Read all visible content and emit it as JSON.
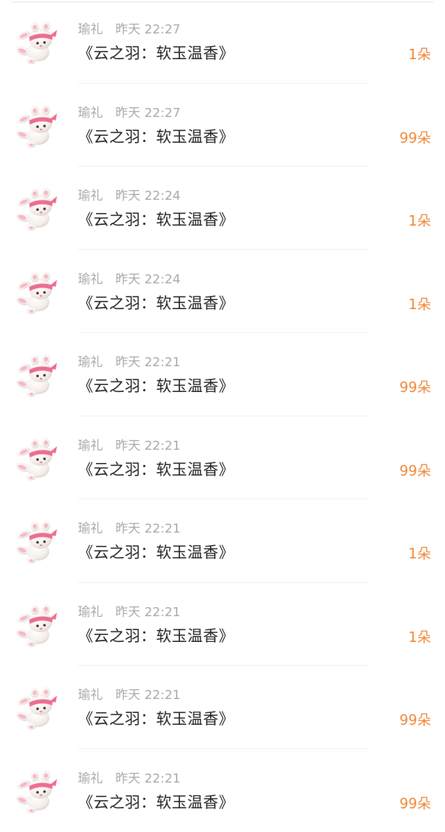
{
  "colors": {
    "name_time": "#a9a9a9",
    "title": "#222222",
    "count": "#f0883a",
    "divider": "#f0f0f0"
  },
  "avatar_icon": "pink-bunny-avatar-icon",
  "items": [
    {
      "name": "瑜礼",
      "time": "昨天 22:27",
      "title": "《云之羽：软玉温香》",
      "count": "1朵"
    },
    {
      "name": "瑜礼",
      "time": "昨天 22:27",
      "title": "《云之羽：软玉温香》",
      "count": "99朵"
    },
    {
      "name": "瑜礼",
      "time": "昨天 22:24",
      "title": "《云之羽：软玉温香》",
      "count": "1朵"
    },
    {
      "name": "瑜礼",
      "time": "昨天 22:24",
      "title": "《云之羽：软玉温香》",
      "count": "1朵"
    },
    {
      "name": "瑜礼",
      "time": "昨天 22:21",
      "title": "《云之羽：软玉温香》",
      "count": "99朵"
    },
    {
      "name": "瑜礼",
      "time": "昨天 22:21",
      "title": "《云之羽：软玉温香》",
      "count": "99朵"
    },
    {
      "name": "瑜礼",
      "time": "昨天 22:21",
      "title": "《云之羽：软玉温香》",
      "count": "1朵"
    },
    {
      "name": "瑜礼",
      "time": "昨天 22:21",
      "title": "《云之羽：软玉温香》",
      "count": "1朵"
    },
    {
      "name": "瑜礼",
      "time": "昨天 22:21",
      "title": "《云之羽：软玉温香》",
      "count": "99朵"
    },
    {
      "name": "瑜礼",
      "time": "昨天 22:21",
      "title": "《云之羽：软玉温香》",
      "count": "99朵"
    }
  ]
}
